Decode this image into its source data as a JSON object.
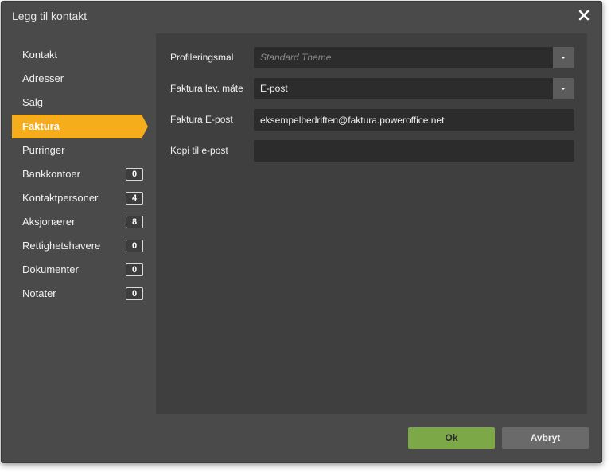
{
  "dialog": {
    "title": "Legg til kontakt",
    "close_icon": "close-icon"
  },
  "sidebar": {
    "items": [
      {
        "label": "Kontakt"
      },
      {
        "label": "Adresser"
      },
      {
        "label": "Salg"
      },
      {
        "label": "Faktura",
        "active": true
      },
      {
        "label": "Purringer"
      },
      {
        "label": "Bankkontoer",
        "count": "0"
      },
      {
        "label": "Kontaktpersoner",
        "count": "4"
      },
      {
        "label": "Aksjonærer",
        "count": "8"
      },
      {
        "label": "Rettighetshavere",
        "count": "0"
      },
      {
        "label": "Dokumenter",
        "count": "0"
      },
      {
        "label": "Notater",
        "count": "0"
      }
    ]
  },
  "form": {
    "profileringsmal": {
      "label": "Profileringsmal",
      "placeholder": "Standard Theme",
      "value": ""
    },
    "leveringsmate": {
      "label": "Faktura lev. måte",
      "value": "E-post"
    },
    "faktura_epost": {
      "label": "Faktura E-post",
      "value": "eksempelbedriften@faktura.poweroffice.net"
    },
    "kopi_epost": {
      "label": "Kopi til e-post",
      "value": ""
    }
  },
  "footer": {
    "ok_label": "Ok",
    "cancel_label": "Avbryt"
  },
  "colors": {
    "accent": "#f5ad1b",
    "ok_button": "#7da847",
    "dialog_bg": "#4a4a4a",
    "panel_bg": "#3f3f3f",
    "field_bg": "#2c2c2c"
  }
}
